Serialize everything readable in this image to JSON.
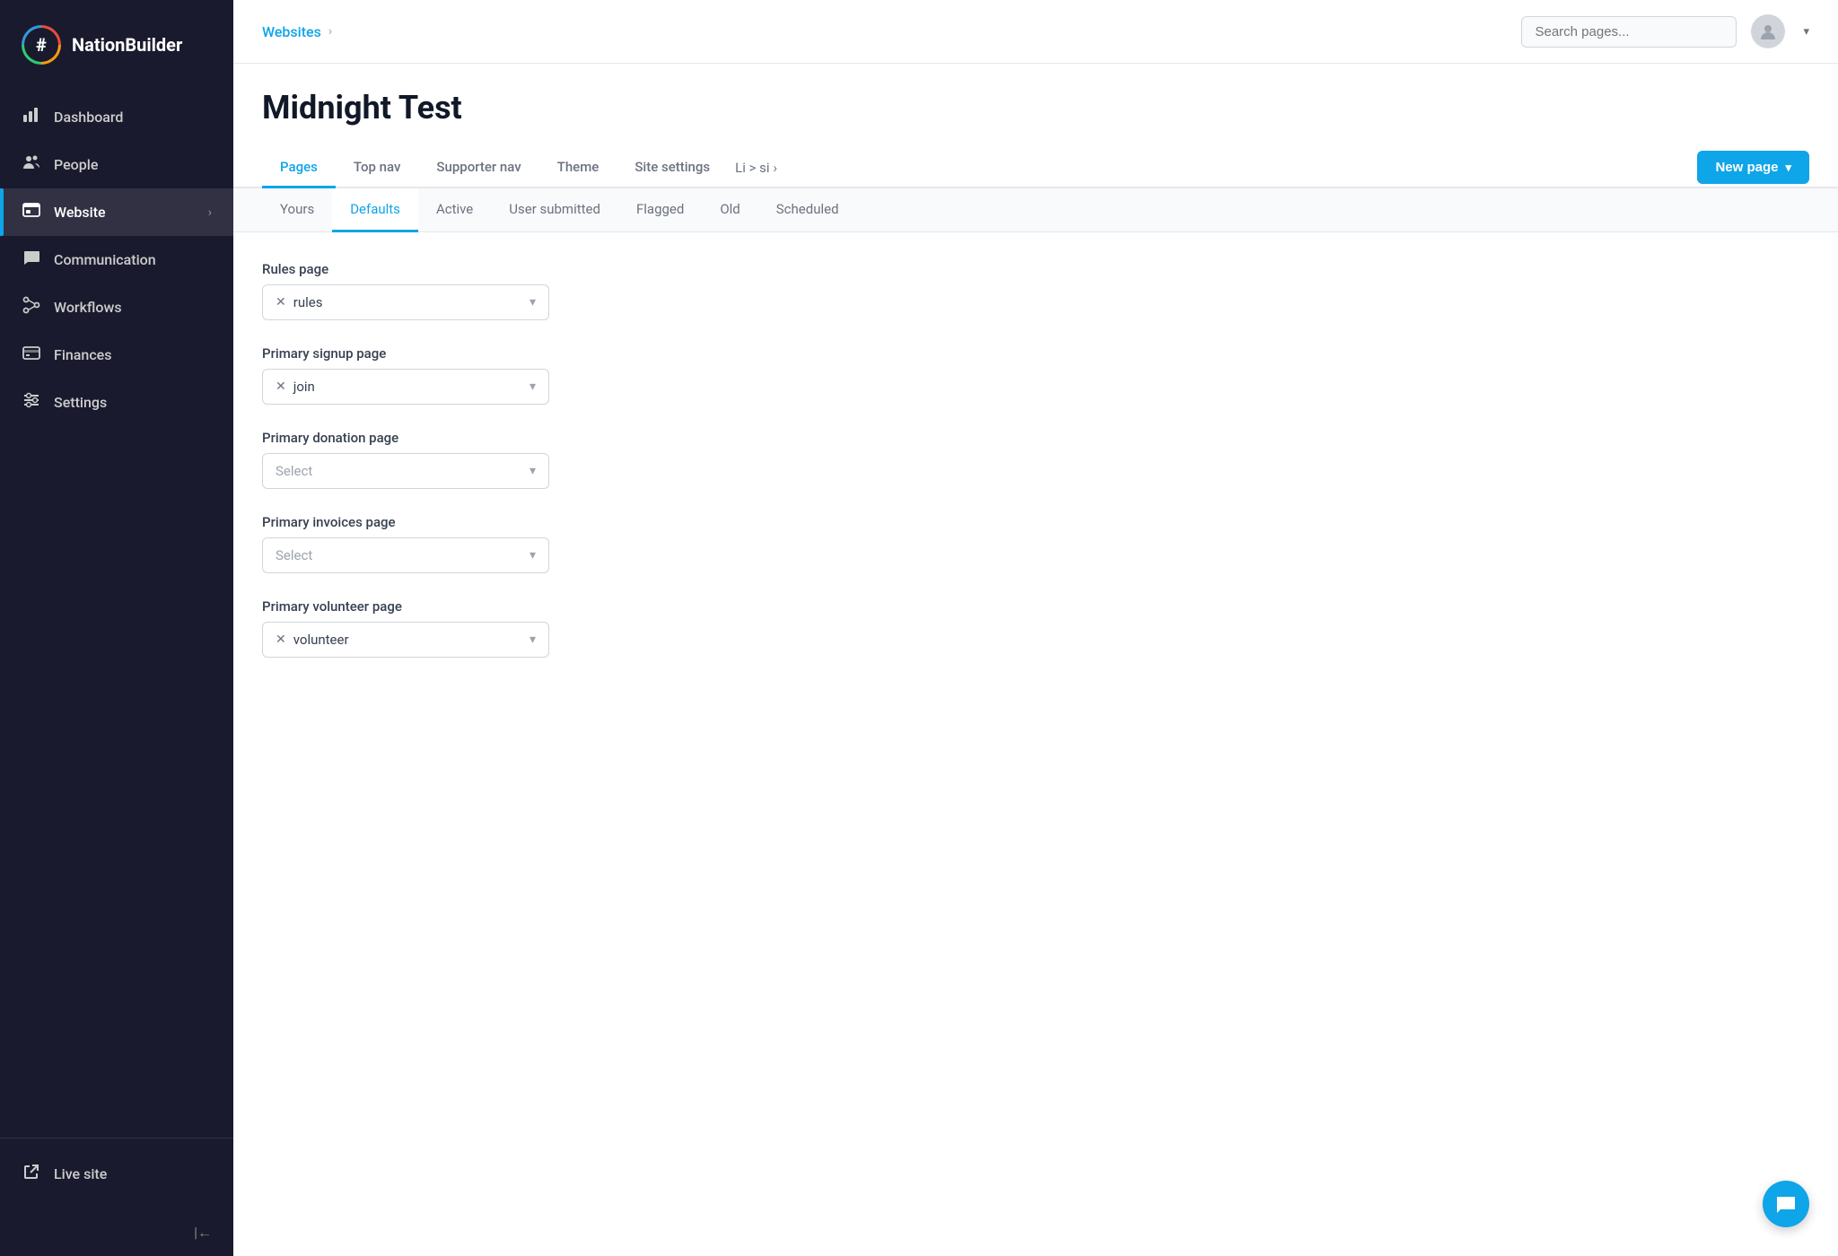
{
  "app": {
    "name": "NationBuilder",
    "logo_symbol": "#"
  },
  "sidebar": {
    "nav_items": [
      {
        "id": "dashboard",
        "label": "Dashboard",
        "icon": "chart-icon",
        "active": false
      },
      {
        "id": "people",
        "label": "People",
        "icon": "people-icon",
        "active": false
      },
      {
        "id": "website",
        "label": "Website",
        "icon": "website-icon",
        "active": true,
        "has_chevron": true
      },
      {
        "id": "communication",
        "label": "Communication",
        "icon": "communication-icon",
        "active": false
      },
      {
        "id": "workflows",
        "label": "Workflows",
        "icon": "workflows-icon",
        "active": false
      },
      {
        "id": "finances",
        "label": "Finances",
        "icon": "finances-icon",
        "active": false
      },
      {
        "id": "settings",
        "label": "Settings",
        "icon": "settings-icon",
        "active": false
      }
    ],
    "bottom_items": [
      {
        "id": "livesite",
        "label": "Live site",
        "icon": "livesite-icon"
      }
    ],
    "collapse_label": "|←"
  },
  "topbar": {
    "breadcrumb": {
      "items": [
        "Websites"
      ],
      "separator": ">"
    },
    "search_placeholder": "Search pages...",
    "user": {
      "avatar_icon": "user-icon"
    }
  },
  "page": {
    "title": "Midnight Test"
  },
  "main_tabs": [
    {
      "id": "pages",
      "label": "Pages",
      "active": true
    },
    {
      "id": "top-nav",
      "label": "Top nav",
      "active": false
    },
    {
      "id": "supporter-nav",
      "label": "Supporter nav",
      "active": false
    },
    {
      "id": "theme",
      "label": "Theme",
      "active": false
    },
    {
      "id": "site-settings",
      "label": "Site settings",
      "active": false
    },
    {
      "id": "overflow",
      "label": "Li > si",
      "active": false
    }
  ],
  "new_page_btn": "New page",
  "sub_tabs": [
    {
      "id": "yours",
      "label": "Yours",
      "active": false
    },
    {
      "id": "defaults",
      "label": "Defaults",
      "active": true
    },
    {
      "id": "active",
      "label": "Active",
      "active": false
    },
    {
      "id": "user-submitted",
      "label": "User submitted",
      "active": false
    },
    {
      "id": "flagged",
      "label": "Flagged",
      "active": false
    },
    {
      "id": "old",
      "label": "Old",
      "active": false
    },
    {
      "id": "scheduled",
      "label": "Scheduled",
      "active": false
    }
  ],
  "form": {
    "fields": [
      {
        "id": "rules-page",
        "label": "Rules page",
        "type": "select",
        "value": "rules",
        "has_clear": true,
        "placeholder": "Select"
      },
      {
        "id": "primary-signup-page",
        "label": "Primary signup page",
        "type": "select",
        "value": "join",
        "has_clear": true,
        "placeholder": "Select"
      },
      {
        "id": "primary-donation-page",
        "label": "Primary donation page",
        "type": "select",
        "value": null,
        "has_clear": false,
        "placeholder": "Select"
      },
      {
        "id": "primary-invoices-page",
        "label": "Primary invoices page",
        "type": "select",
        "value": null,
        "has_clear": false,
        "placeholder": "Select"
      },
      {
        "id": "primary-volunteer-page",
        "label": "Primary volunteer page",
        "type": "select",
        "value": "volunteer",
        "has_clear": true,
        "placeholder": "Select"
      }
    ]
  },
  "chat_btn_icon": "chat-icon",
  "colors": {
    "accent": "#0ea5e9",
    "sidebar_bg": "#1a1a2e"
  }
}
